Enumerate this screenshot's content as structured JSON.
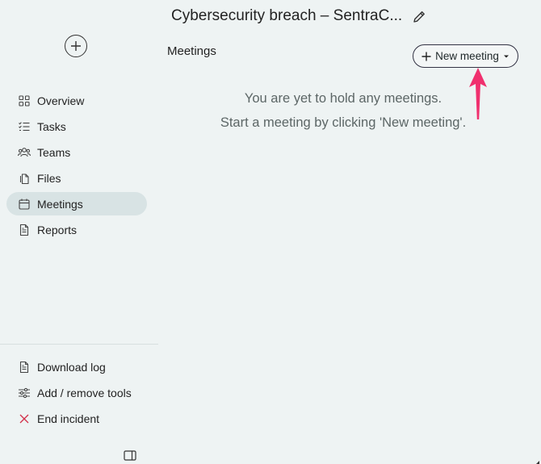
{
  "header": {
    "title": "Cybersecurity breach – SentraC..."
  },
  "sidebar": {
    "items": [
      {
        "label": "Overview",
        "icon": "grid-icon"
      },
      {
        "label": "Tasks",
        "icon": "checklist-icon"
      },
      {
        "label": "Teams",
        "icon": "people-icon"
      },
      {
        "label": "Files",
        "icon": "files-icon"
      },
      {
        "label": "Meetings",
        "icon": "calendar-icon",
        "active": true
      },
      {
        "label": "Reports",
        "icon": "document-icon"
      }
    ],
    "bottom_items": [
      {
        "label": "Download log",
        "icon": "document-icon"
      },
      {
        "label": "Add / remove tools",
        "icon": "sliders-icon"
      },
      {
        "label": "End incident",
        "icon": "close-icon"
      }
    ]
  },
  "main": {
    "section_title": "Meetings",
    "new_button_label": "New meeting",
    "empty_line1": "You are yet to hold any meetings.",
    "empty_line2": "Start a meeting by clicking 'New meeting'."
  },
  "colors": {
    "accent_arrow": "#f0306e",
    "active_bg": "#d8e3e4",
    "background": "#eef3f3"
  }
}
